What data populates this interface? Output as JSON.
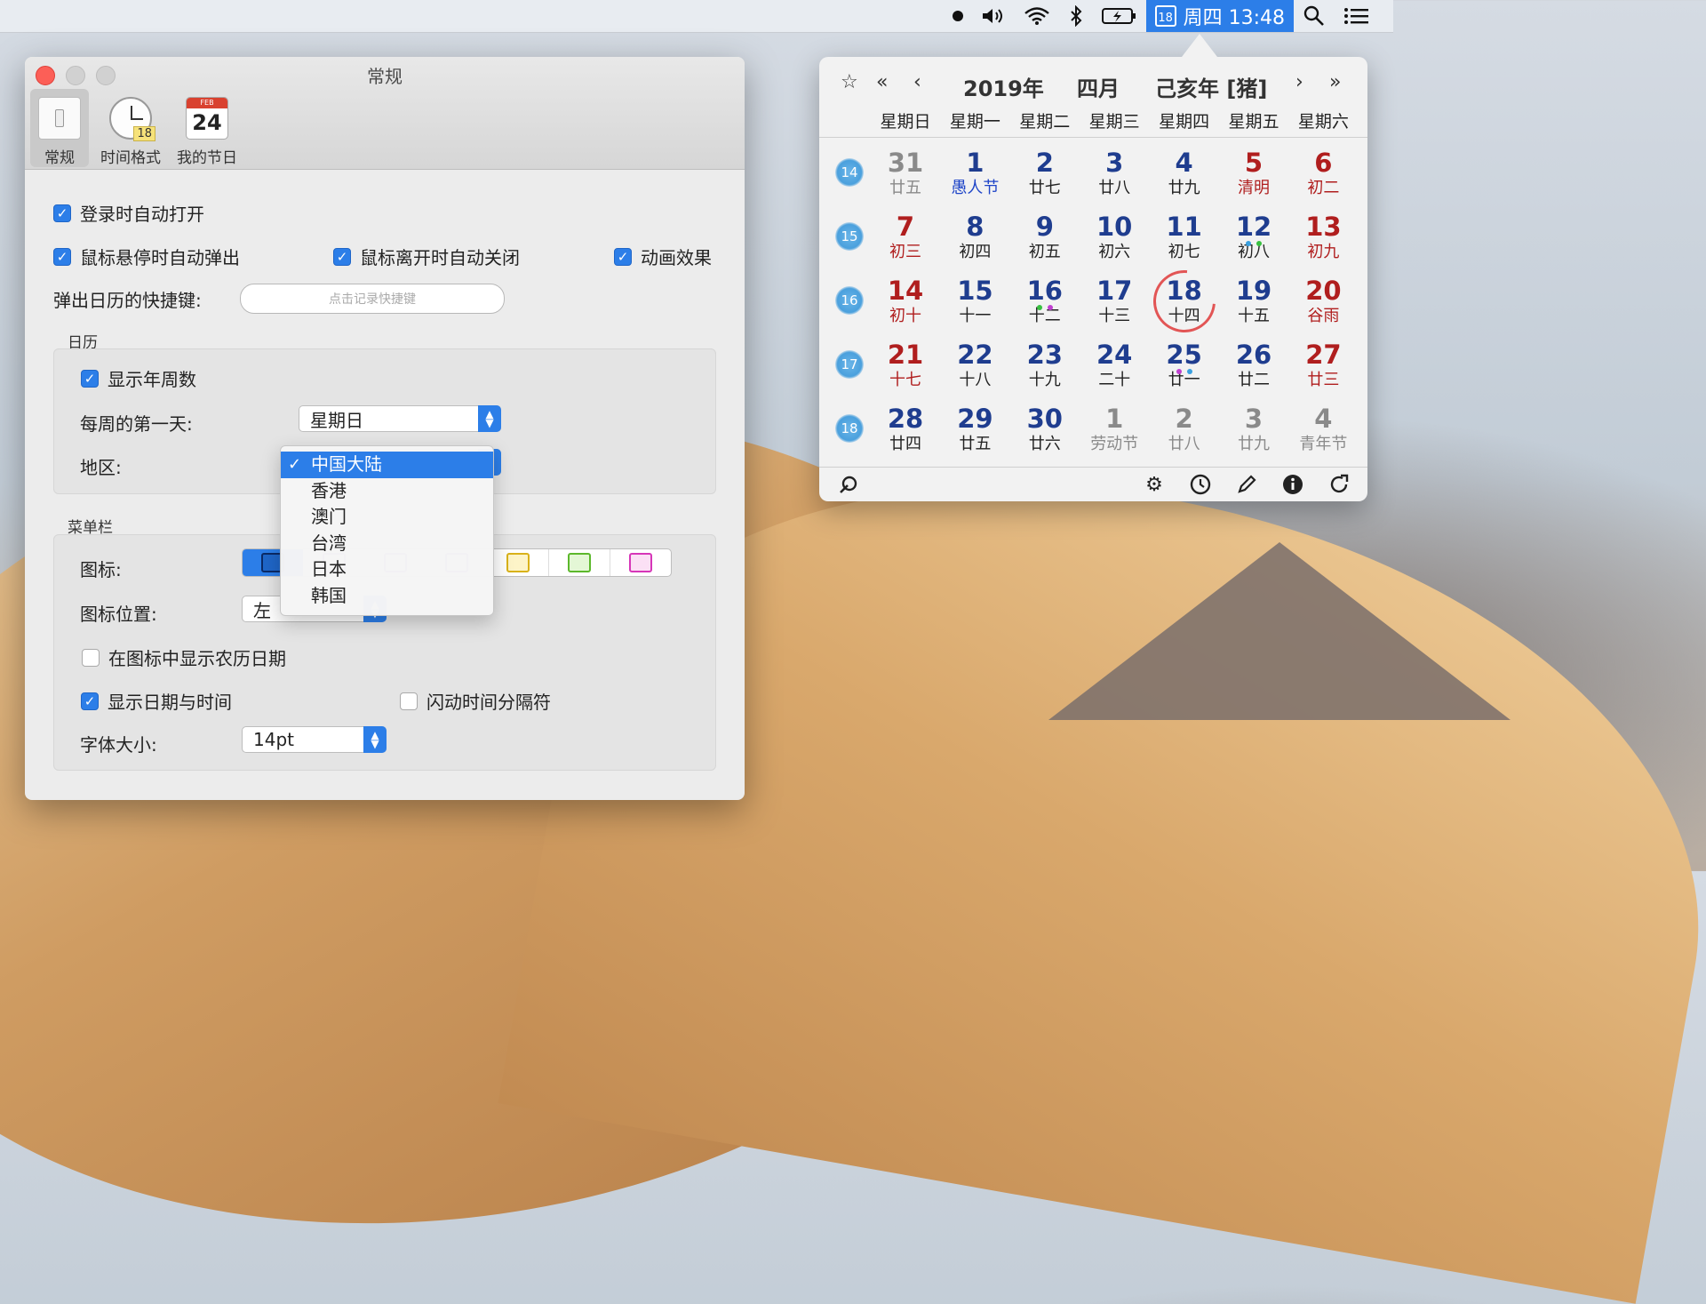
{
  "menubar": {
    "clock_day": "18",
    "clock_text": "周四 13:48"
  },
  "prefs": {
    "title": "常规",
    "tabs": [
      {
        "label": "常规",
        "icon": "switch-icon"
      },
      {
        "label": "时间格式",
        "icon": "clock-icon",
        "badge": "18"
      },
      {
        "label": "我的节日",
        "icon": "calendar-icon",
        "month": "FEB",
        "day": "24"
      }
    ],
    "general": {
      "auto_open_login": "登录时自动打开",
      "hover_popup": "鼠标悬停时自动弹出",
      "leave_close": "鼠标离开时自动关闭",
      "animation": "动画效果",
      "shortcut_label": "弹出日历的快捷键:",
      "shortcut_placeholder": "点击记录快捷键"
    },
    "calendar_section": {
      "title": "日历",
      "show_week_numbers": "显示年周数",
      "first_day_label": "每周的第一天:",
      "first_day_value": "星期日",
      "region_label": "地区:"
    },
    "region_dropdown": {
      "options": [
        "中国大陆",
        "香港",
        "澳门",
        "台湾",
        "日本",
        "韩国"
      ],
      "selected": "中国大陆"
    },
    "menubar_section": {
      "title": "菜单栏",
      "icon_label": "图标:",
      "icon_position_label": "图标位置:",
      "icon_position_value": "左",
      "show_lunar_in_icon": "在图标中显示农历日期",
      "show_date_time": "显示日期与时间",
      "blink_separator": "闪动时间分隔符",
      "font_size_label": "字体大小:",
      "font_size_value": "14pt",
      "icon_colors": [
        "#1f66c8",
        "#7b3fc4",
        "#d9b21a",
        "#5cb82c",
        "#d636b8"
      ]
    }
  },
  "calendar": {
    "year": "2019年",
    "month": "四月",
    "ganzhi": "己亥年 [猪]",
    "weekdays": [
      "星期日",
      "星期一",
      "星期二",
      "星期三",
      "星期四",
      "星期五",
      "星期六"
    ],
    "weeks": [
      {
        "no": "14",
        "days": [
          {
            "d": "31",
            "l": "廿五",
            "c": "gray"
          },
          {
            "d": "1",
            "l": "愚人节",
            "c": "blue",
            "h": "hol"
          },
          {
            "d": "2",
            "l": "廿七",
            "c": "blue"
          },
          {
            "d": "3",
            "l": "廿八",
            "c": "blue"
          },
          {
            "d": "4",
            "l": "廿九",
            "c": "blue"
          },
          {
            "d": "5",
            "l": "清明",
            "c": "red"
          },
          {
            "d": "6",
            "l": "初二",
            "c": "red"
          }
        ]
      },
      {
        "no": "15",
        "days": [
          {
            "d": "7",
            "l": "初三",
            "c": "red"
          },
          {
            "d": "8",
            "l": "初四",
            "c": "blue"
          },
          {
            "d": "9",
            "l": "初五",
            "c": "blue"
          },
          {
            "d": "10",
            "l": "初六",
            "c": "blue"
          },
          {
            "d": "11",
            "l": "初七",
            "c": "blue"
          },
          {
            "d": "12",
            "l": "初八",
            "c": "blue",
            "dots": [
              "#3aa0e0",
              "#38c040"
            ]
          },
          {
            "d": "13",
            "l": "初九",
            "c": "red"
          }
        ]
      },
      {
        "no": "16",
        "days": [
          {
            "d": "14",
            "l": "初十",
            "c": "red"
          },
          {
            "d": "15",
            "l": "十一",
            "c": "blue"
          },
          {
            "d": "16",
            "l": "十二",
            "c": "blue",
            "dots": [
              "#38c040",
              "#c040d0"
            ]
          },
          {
            "d": "17",
            "l": "十三",
            "c": "blue"
          },
          {
            "d": "18",
            "l": "十四",
            "c": "blue",
            "today": true
          },
          {
            "d": "19",
            "l": "十五",
            "c": "blue"
          },
          {
            "d": "20",
            "l": "谷雨",
            "c": "red"
          }
        ]
      },
      {
        "no": "17",
        "days": [
          {
            "d": "21",
            "l": "十七",
            "c": "red"
          },
          {
            "d": "22",
            "l": "十八",
            "c": "blue"
          },
          {
            "d": "23",
            "l": "十九",
            "c": "blue"
          },
          {
            "d": "24",
            "l": "二十",
            "c": "blue"
          },
          {
            "d": "25",
            "l": "廿一",
            "c": "blue",
            "dots": [
              "#c040d0",
              "#3aa0e0"
            ]
          },
          {
            "d": "26",
            "l": "廿二",
            "c": "blue"
          },
          {
            "d": "27",
            "l": "廿三",
            "c": "red"
          }
        ]
      },
      {
        "no": "18",
        "days": [
          {
            "d": "28",
            "l": "廿四",
            "c": "blue"
          },
          {
            "d": "29",
            "l": "廿五",
            "c": "blue"
          },
          {
            "d": "30",
            "l": "廿六",
            "c": "blue"
          },
          {
            "d": "1",
            "l": "劳动节",
            "c": "gray"
          },
          {
            "d": "2",
            "l": "廿八",
            "c": "gray"
          },
          {
            "d": "3",
            "l": "廿九",
            "c": "gray"
          },
          {
            "d": "4",
            "l": "青年节",
            "c": "gray"
          }
        ]
      }
    ]
  }
}
